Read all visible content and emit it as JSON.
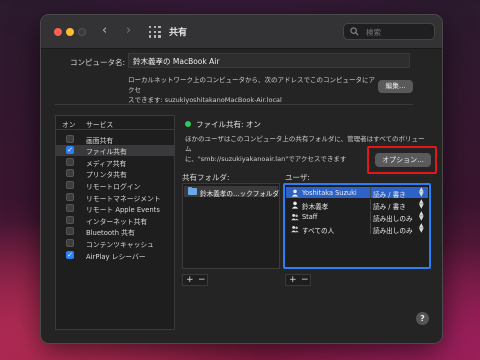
{
  "window": {
    "title": "共有",
    "search_placeholder": "検索"
  },
  "computer": {
    "name_label": "コンピュータ名:",
    "name_value": "鈴木義孝の MacBook Air",
    "description_line1": "ローカルネットワーク上のコンピュータから、次のアドレスでこのコンピュータにアクセ",
    "description_line2": "スできます: suzukiyoshitakanoMacBook-Air.local",
    "edit_button": "編集..."
  },
  "services": {
    "header_on": "オン",
    "header_service": "サービス",
    "items": [
      {
        "label": "画面共有",
        "checked": false,
        "selected": false
      },
      {
        "label": "ファイル共有",
        "checked": true,
        "selected": true
      },
      {
        "label": "メディア共有",
        "checked": false,
        "selected": false
      },
      {
        "label": "プリンタ共有",
        "checked": false,
        "selected": false
      },
      {
        "label": "リモートログイン",
        "checked": false,
        "selected": false
      },
      {
        "label": "リモートマネージメント",
        "checked": false,
        "selected": false
      },
      {
        "label": "リモート Apple Events",
        "checked": false,
        "selected": false
      },
      {
        "label": "インターネット共有",
        "checked": false,
        "selected": false
      },
      {
        "label": "Bluetooth 共有",
        "checked": false,
        "selected": false
      },
      {
        "label": "コンテンツキャッシュ",
        "checked": false,
        "selected": false
      },
      {
        "label": "AirPlay レシーバー",
        "checked": true,
        "selected": false
      }
    ]
  },
  "file_sharing": {
    "status": "ファイル共有: オン",
    "status_color": "#34c759",
    "description_line1": "ほかのユーザはこのコンピュータ上の共有フォルダに、管理者はすべてのボリューム",
    "description_line2": "に、\"smb://suzukiyakanoair.lan\"でアクセスできます",
    "options_button": "オプション...",
    "highlight_color": "#e01818",
    "folders_label": "共有フォルダ:",
    "users_label": "ユーザ:",
    "folders": [
      "鈴木義孝の…ックフォルダ"
    ],
    "users": [
      {
        "name": "Yoshitaka Suzuki",
        "permission": "読み / 書き",
        "icon": "user-icon",
        "selected": true
      },
      {
        "name": "鈴木義孝",
        "permission": "読み / 書き",
        "icon": "user-icon",
        "selected": false
      },
      {
        "name": "Staff",
        "permission": "読み出しのみ",
        "icon": "group-icon",
        "selected": false
      },
      {
        "name": "すべての人",
        "permission": "読み出しのみ",
        "icon": "group-icon",
        "selected": false
      }
    ],
    "add_symbol": "+",
    "remove_symbol": "−"
  },
  "help": {
    "label": "?"
  }
}
